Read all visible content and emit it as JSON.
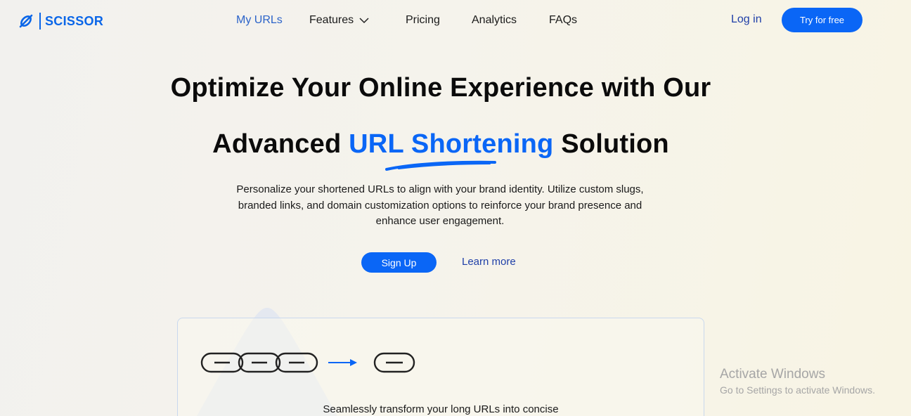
{
  "brand": {
    "name": "SCISSOR",
    "icon": "link-slash-icon",
    "color": "#0a66e8"
  },
  "nav": {
    "items": [
      {
        "label": "My URLs",
        "active": true
      },
      {
        "label": "Features",
        "has_dropdown": true
      },
      {
        "label": "Pricing"
      },
      {
        "label": "Analytics"
      },
      {
        "label": "FAQs"
      }
    ],
    "login_label": "Log in",
    "cta_label": "Try for free"
  },
  "hero": {
    "title_line1": "Optimize Your Online Experience with Our",
    "title_line2_pre": "Advanced",
    "title_line2_highlight": "URL Shortening",
    "title_line2_post": "Solution",
    "description": "Personalize your shortened URLs to align with your brand identity. Utilize custom slugs, branded links, and domain customization options to reinforce your brand presence and enhance user engagement.",
    "primary_button": "Sign Up",
    "secondary_link": "Learn more",
    "accent_color": "#0a66f6"
  },
  "feature_card": {
    "icons": [
      "long-chain-link-icon",
      "arrow-right-icon",
      "short-chain-link-icon"
    ],
    "text": "Seamlessly transform your long URLs into concise"
  },
  "watermark": {
    "title": "Activate Windows",
    "subtitle": "Go to Settings to activate Windows."
  }
}
